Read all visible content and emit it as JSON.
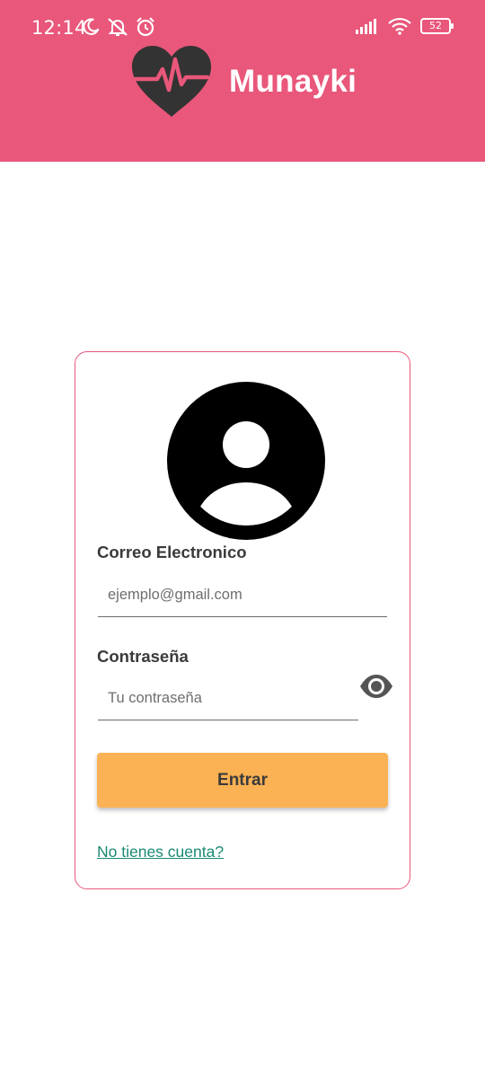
{
  "status_bar": {
    "time": "12:14",
    "battery_level": "52",
    "icons_left": [
      "moon-icon",
      "notifications-muted-icon",
      "alarm-icon"
    ],
    "icons_right": [
      "signal-icon",
      "wifi-icon",
      "battery-icon"
    ]
  },
  "header": {
    "app_name": "Munayki",
    "background_color": "#e9577b",
    "logo_icon": "heart-pulse-icon"
  },
  "login_form": {
    "avatar_icon": "user-avatar-icon",
    "email": {
      "label": "Correo Electronico",
      "placeholder": "ejemplo@gmail.com",
      "value": ""
    },
    "password": {
      "label": "Contraseña",
      "placeholder": "Tu contraseña",
      "value": "",
      "toggle_icon": "eye-icon"
    },
    "submit_label": "Entrar",
    "signup_link": "No tienes cuenta?",
    "border_color": "#e9577b",
    "button_color": "#fbb254",
    "link_color": "#1a8a74"
  }
}
